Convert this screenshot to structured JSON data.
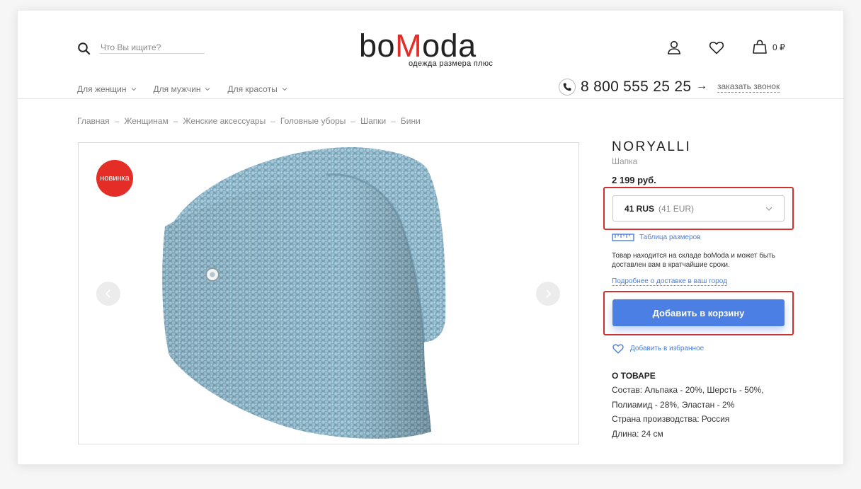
{
  "header": {
    "search_placeholder": "Что Вы ищите?",
    "logo": {
      "prefix": "bo",
      "accent": "M",
      "suffix": "oda",
      "tagline": "одежда размера плюс"
    },
    "cart_sum": "0 ₽",
    "nav": [
      {
        "label": "Для женщин"
      },
      {
        "label": "Для мужчин"
      },
      {
        "label": "Для красоты"
      }
    ],
    "phone": "8 800 555 25 25",
    "arrow": "→",
    "callback": "заказать звонок"
  },
  "breadcrumb": [
    "Главная",
    "Женщинам",
    "Женские аксессуары",
    "Головные уборы",
    "Шапки",
    "Бини"
  ],
  "breadcrumb_sep": "–",
  "gallery": {
    "badge": "новинка"
  },
  "product": {
    "brand": "NORYALLI",
    "type": "Шапка",
    "price": "2 199 руб.",
    "size_main": "41 RUS",
    "size_alt": "(41 EUR)",
    "size_table": "Таблица размеров",
    "stock_text": "Товар находится на складе boModa и может быть доставлен вам в кратчайшие сроки.",
    "delivery_link": "Подробнее о доставке в ваш город",
    "add_to_cart": "Добавить в корзину",
    "add_to_fav": "Добавить в избранное",
    "about_title": "О ТОВАРЕ",
    "about_lines": [
      "Состав: Альпака - 20%, Шерсть - 50%,",
      "Полиамид - 28%, Эластан - 2%",
      "Страна производства: Россия",
      "Длина: 24 см"
    ]
  },
  "colors": {
    "accent": "#4b7fe3",
    "brand_red": "#e52d27",
    "highlight": "#d32f2f"
  }
}
